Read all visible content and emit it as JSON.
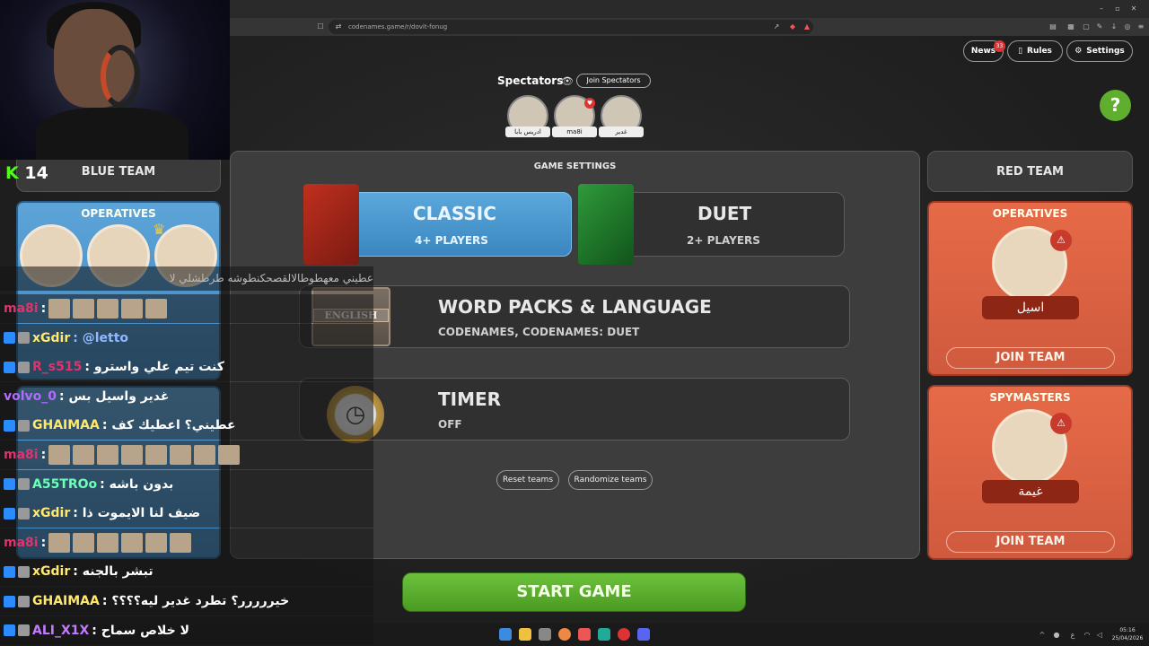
{
  "browser": {
    "url": "codenames.game/r/dovit-fonug"
  },
  "header": {
    "news_label": "News",
    "news_count": "33",
    "rules_label": "Rules",
    "settings_label": "Settings",
    "help_label": "?"
  },
  "spectators": {
    "title": "Spectators",
    "join_label": "Join Spectators",
    "people": [
      {
        "name": "ادريس بابا"
      },
      {
        "name": "ma8i"
      },
      {
        "name": "غدير"
      }
    ]
  },
  "blue_team": {
    "header": "BLUE TEAM",
    "operatives_title": "OPERATIVES"
  },
  "red_team": {
    "header": "RED TEAM",
    "operatives": {
      "title": "OPERATIVES",
      "player": "اسيل",
      "join_label": "JOIN TEAM"
    },
    "spymasters": {
      "title": "SPYMASTERS",
      "player": "غيمة",
      "join_label": "JOIN TEAM"
    }
  },
  "game_settings": {
    "title": "GAME SETTINGS",
    "modes": [
      {
        "title": "CLASSIC",
        "subtitle": "4+ PLAYERS",
        "selected": true
      },
      {
        "title": "DUET",
        "subtitle": "2+ PLAYERS",
        "selected": false
      }
    ],
    "word_packs": {
      "title": "WORD PACKS & LANGUAGE",
      "subtitle": "CODENAMES, CODENAMES: DUET",
      "box_label": "ENGLISH"
    },
    "timer": {
      "title": "TIMER",
      "subtitle": "OFF"
    },
    "reset_label": "Reset teams",
    "randomize_label": "Randomize teams"
  },
  "start_label": "START GAME",
  "stream": {
    "viewer_count": "14"
  },
  "chat": [
    {
      "user": "ma8i",
      "color": "#e0336b",
      "text": ":",
      "emotes": 5
    },
    {
      "user": "xGdir",
      "color": "#ffe86b",
      "text": ": @letto",
      "mention_color": "#8fb8ff"
    },
    {
      "user": "R_s515",
      "color": "#e0336b",
      "text": ": كنت تيم علي واسترو"
    },
    {
      "user": "volvo_0",
      "color": "#b06bff",
      "text": ": غدير واسيل بس"
    },
    {
      "user": "GHAIMAA",
      "color": "#ffe86b",
      "text": ": عطيني؟ اعطيك كف"
    },
    {
      "user": "ma8i",
      "color": "#e0336b",
      "text": ":",
      "emotes": 8
    },
    {
      "user": "A55TROo",
      "color": "#6bffb8",
      "text": ": بدون باشه"
    },
    {
      "user": "xGdir",
      "color": "#ffe86b",
      "text": ": ضيف لنا الايموت ذا"
    },
    {
      "user": "ma8i",
      "color": "#e0336b",
      "text": ":",
      "emotes": 6
    },
    {
      "user": "xGdir",
      "color": "#ffe86b",
      "text": ": تبشر بالجنه"
    },
    {
      "user": "GHAIMAA",
      "color": "#ffe86b",
      "text": ": خيررررر؟ تطرد غدير ليه؟؟؟؟"
    },
    {
      "user": "ALI_X1X",
      "color": "#c27bff",
      "text": ": لا خلاص سماح"
    }
  ],
  "chat_top_partial": "عطيني معهطوطالالقصحكنطوشه طرطشلي لا",
  "clock": {
    "time": "05:16",
    "date": "25/04/2026"
  },
  "colors": {
    "accent_green": "#5fae2e",
    "classic_blue": "#4a9bd1",
    "red_card": "#e0643f",
    "start_green": "#5bb02c"
  }
}
